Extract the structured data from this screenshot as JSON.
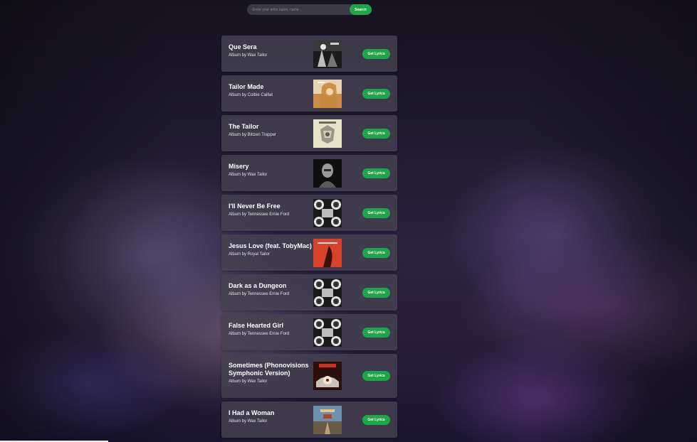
{
  "search": {
    "placeholder": "Enter your artist name, name",
    "button_label": "Search"
  },
  "results": [
    {
      "title": "Que Sera",
      "subtitle": "Album by Wax Tailor",
      "button": "Get Lyrics",
      "cover": "que-sera-cover"
    },
    {
      "title": "Tailor Made",
      "subtitle": "Album by Colbie Caillat",
      "button": "Get Lyrics",
      "cover": "tailor-made-cover"
    },
    {
      "title": "The Tailor",
      "subtitle": "Album by Blitzen Trapper",
      "button": "Get Lyrics",
      "cover": "the-tailor-cover"
    },
    {
      "title": "Misery",
      "subtitle": "Album by Wax Tailor",
      "button": "Get Lyrics",
      "cover": "misery-cover"
    },
    {
      "title": "I'll Never Be Free",
      "subtitle": "Album by Tennessee Ernie Ford",
      "button": "Get Lyrics",
      "cover": "ill-never-be-free-cover"
    },
    {
      "title": "Jesus Love (feat. TobyMac)",
      "subtitle": "Album by Royal Tailor",
      "button": "Get Lyrics",
      "cover": "jesus-love-cover"
    },
    {
      "title": "Dark as a Dungeon",
      "subtitle": "Album by Tennessee Ernie Ford",
      "button": "Get Lyrics",
      "cover": "dark-as-a-dungeon-cover"
    },
    {
      "title": "False Hearted Girl",
      "subtitle": "Album by Tennessee Ernie Ford",
      "button": "Get Lyrics",
      "cover": "false-hearted-girl-cover"
    },
    {
      "title": "Sometimes (Phonovisions Symphonic Version)",
      "subtitle": "Album by Wax Tailor",
      "button": "Get Lyrics",
      "cover": "sometimes-cover"
    },
    {
      "title": "I Had a Woman",
      "subtitle": "Album by Wax Tailor",
      "button": "Get Lyrics",
      "cover": "i-had-a-woman-cover"
    }
  ],
  "colors": {
    "accent": "#1ea74a",
    "card": "#46424f",
    "text": "#ffffff"
  }
}
